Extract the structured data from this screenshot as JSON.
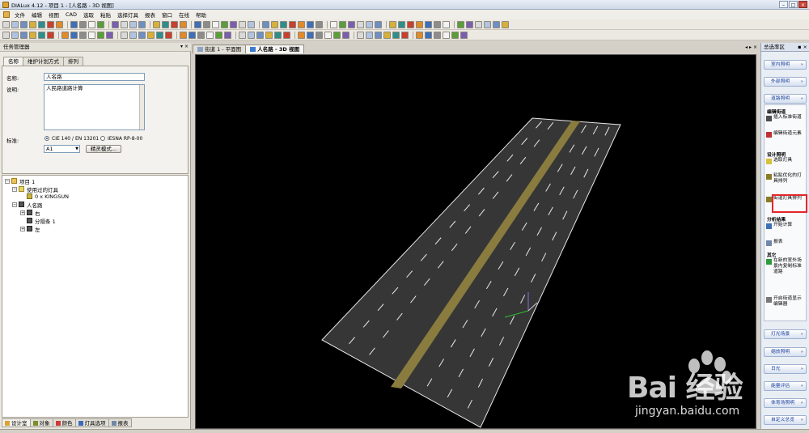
{
  "window": {
    "title": "DIALux 4.12 - 项目 1 - [人名路 - 3D 视图]"
  },
  "menu": [
    "文件",
    "编辑",
    "视图",
    "CAD",
    "选取",
    "粘贴",
    "选择灯具",
    "报表",
    "窗口",
    "在线",
    "帮助"
  ],
  "left_panel": {
    "title": "任务管理器",
    "tabs": [
      "名称",
      "维护计划方式",
      "排列"
    ],
    "props": {
      "name_label": "名称:",
      "name_value": "人名路",
      "desc_label": "说明:",
      "desc_value": "人民路道路计算",
      "standard_label": "标准:",
      "standard_opt1": "CIE 140 / EN 13201",
      "standard_opt2": "IESNA RP-8-00",
      "class_value": "A1",
      "expert_button": "精灵模式..."
    },
    "tree": {
      "project": "项目 1",
      "used_luminaires": "使用过的灯具",
      "luminaire": "0 x KINGSUN",
      "street": "人名路",
      "right": "右",
      "divider": "分隔条 1",
      "left": "左"
    },
    "bottom_tabs": [
      "设计室",
      "对象",
      "颜色",
      "灯具选项",
      "报表"
    ]
  },
  "view_tabs": [
    "街道 1 - 平面图",
    "人名路 - 3D 视图"
  ],
  "view_ctrl": "◂ ▸ ×",
  "right_panel": {
    "title": "总选率区",
    "sections_top": [
      "室内照明",
      "外部照明",
      "道路照明"
    ],
    "groups": {
      "edit_street": "编辑街道",
      "design": "设计照明",
      "analysis": "分析结果",
      "other": "其它"
    },
    "items": {
      "insert_std_street": "插入标准街道",
      "edit_street_elem": "编辑街道元素",
      "select_lum": "选取灯具",
      "optimize": "粘贴优化的灯具排列",
      "street_lum_arr": "街道灯具排列",
      "start_calc": "开始计算",
      "report": "报表",
      "copy_new": "在新的室外场景内复制标准道路",
      "open_editor": "开启街道显示编辑器"
    },
    "sections_bottom": [
      "灯光场景",
      "缩放照明",
      "日光",
      "能量评估",
      "体育场照明",
      "自定义总览"
    ]
  },
  "watermark": {
    "brand": "Bai 经验",
    "url": "jingyan.baidu.com"
  },
  "colors": {
    "highlight": "#e3262b",
    "road_center": "#8a7c3e",
    "road": "#3a3a3a"
  }
}
